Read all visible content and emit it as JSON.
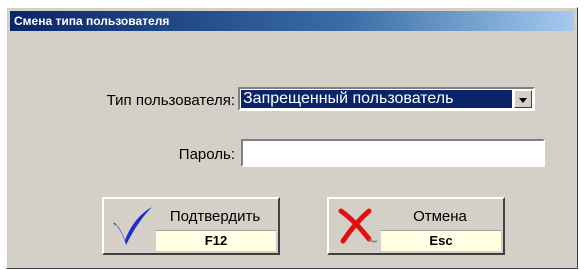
{
  "dialog": {
    "title": "Смена типа пользователя"
  },
  "form": {
    "user_type_label": "Тип пользователя:",
    "user_type_value": "Запрещенный пользователь",
    "password_label": "Пароль:",
    "password_value": ""
  },
  "buttons": {
    "confirm": {
      "label": "Подтвердить",
      "hotkey": "F12",
      "icon": "checkmark-icon",
      "color": "#1a2fd0"
    },
    "cancel": {
      "label": "Отмена",
      "hotkey": "Esc",
      "icon": "cross-icon",
      "color": "#e01010"
    }
  }
}
